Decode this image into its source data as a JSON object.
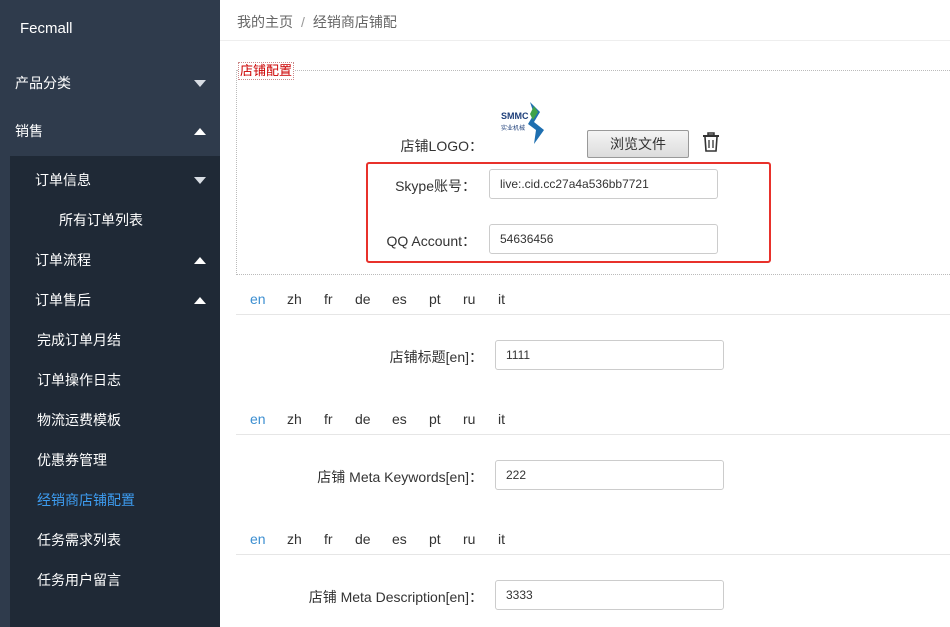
{
  "sidebar": {
    "brand": "Fecmall",
    "top_items": [
      {
        "label": "产品分类"
      },
      {
        "label": "销售"
      }
    ],
    "sub_items": [
      {
        "label": "订单信息"
      },
      {
        "label": "所有订单列表"
      },
      {
        "label": "订单流程"
      },
      {
        "label": "订单售后"
      },
      {
        "label": "完成订单月结"
      },
      {
        "label": "订单操作日志"
      },
      {
        "label": "物流运费模板"
      },
      {
        "label": "优惠券管理"
      },
      {
        "label": "经销商店铺配置"
      },
      {
        "label": "任务需求列表"
      },
      {
        "label": "任务用户留言"
      }
    ],
    "active_color": "#3d9cf0"
  },
  "breadcrumb": {
    "home": "我的主页",
    "separator": "/",
    "current": "经销商店铺配"
  },
  "store_config": {
    "legend": "店铺配置",
    "logo_label": "店铺LOGO：",
    "logo_text": "SMMC",
    "logo_subtext": "实业机械",
    "browse_label": "浏览文件",
    "skype_label": "Skype账号：",
    "skype_value": "live:.cid.cc27a4a536bb7721",
    "qq_label": "QQ Account：",
    "qq_value": "54636456",
    "highlight_color": "#e8312b"
  },
  "languages": [
    "en",
    "zh",
    "fr",
    "de",
    "es",
    "pt",
    "ru",
    "it"
  ],
  "fields": {
    "title_label": "店铺标题[en]：",
    "title_value": "1111",
    "keywords_label": "店铺 Meta Keywords[en]：",
    "keywords_value": "222",
    "description_label": "店铺 Meta Description[en]：",
    "description_value": "3333"
  }
}
